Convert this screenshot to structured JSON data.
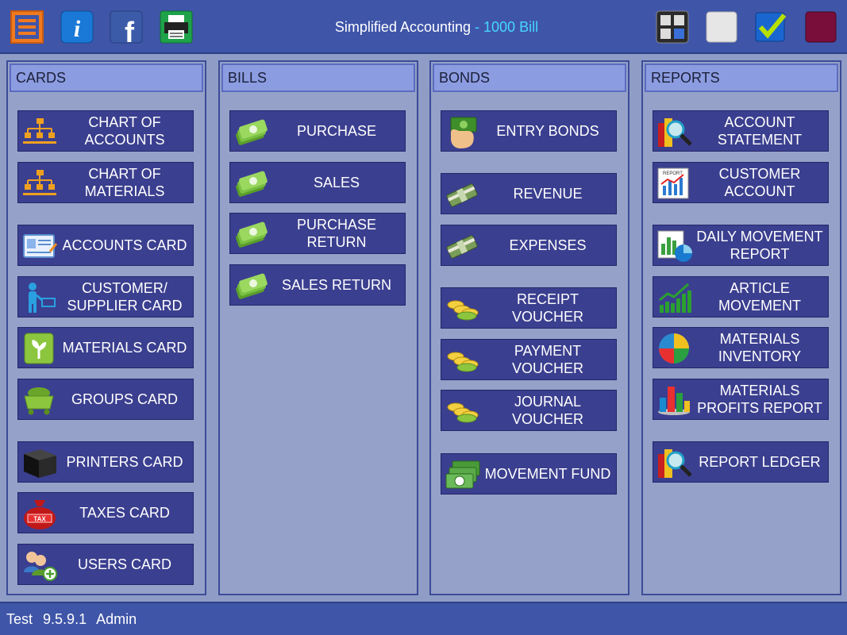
{
  "header": {
    "title_main": "Simplified Accounting",
    "title_accent": " - 1000 Bill",
    "icons": [
      "menu-icon",
      "info-icon",
      "facebook-icon",
      "printer-icon",
      "calculator-icon",
      "blank-tile-icon",
      "checkbox-icon",
      "color-swatch-icon"
    ],
    "accent_color": "#48d6ff",
    "bar_color": "#3f55a8"
  },
  "cards": {
    "title": "CARDS",
    "items": [
      {
        "label": "CHART OF\nACCOUNTS",
        "icon": "org-chart-icon"
      },
      {
        "label": "CHART OF\nMATERIALS",
        "icon": "org-chart-icon"
      },
      {
        "label": "ACCOUNTS CARD",
        "icon": "id-card-icon"
      },
      {
        "label": "CUSTOMER/\nSUPPLIER CARD",
        "icon": "shopper-icon"
      },
      {
        "label": "MATERIALS CARD",
        "icon": "seed-bag-icon"
      },
      {
        "label": "GROUPS CARD",
        "icon": "cart-icon"
      },
      {
        "label": "PRINTERS CARD",
        "icon": "printer-box-icon"
      },
      {
        "label": "TAXES CARD",
        "icon": "tax-bag-icon"
      },
      {
        "label": "USERS CARD",
        "icon": "users-add-icon"
      }
    ]
  },
  "bills": {
    "title": "BILLS",
    "items": [
      {
        "label": "PURCHASE",
        "icon": "cash-stack-icon"
      },
      {
        "label": "SALES",
        "icon": "cash-stack-icon"
      },
      {
        "label": "PURCHASE RETURN",
        "icon": "cash-stack-icon"
      },
      {
        "label": "SALES RETURN",
        "icon": "cash-stack-icon"
      }
    ]
  },
  "bonds": {
    "title": "BONDS",
    "items": [
      {
        "label": "ENTRY BONDS",
        "icon": "cash-hand-icon"
      },
      {
        "label": "REVENUE",
        "icon": "money-bundle-icon"
      },
      {
        "label": "EXPENSES",
        "icon": "money-bundle-icon"
      },
      {
        "label": "RECEIPT VOUCHER",
        "icon": "coins-icon"
      },
      {
        "label": "PAYMENT VOUCHER",
        "icon": "coins-icon"
      },
      {
        "label": "JOURNAL VOUCHER",
        "icon": "coins-icon"
      },
      {
        "label": "MOVEMENT FUND",
        "icon": "bills-stack-icon"
      }
    ]
  },
  "reports": {
    "title": "REPORTS",
    "items": [
      {
        "label": "ACCOUNT\nSTATEMENT",
        "icon": "magnifier-chart-icon"
      },
      {
        "label": "CUSTOMER\nACCOUNT",
        "icon": "report-chart-icon"
      },
      {
        "label": "DAILY MOVEMENT\nREPORT",
        "icon": "pie-report-icon"
      },
      {
        "label": "ARTICLE\nMOVEMENT",
        "icon": "trend-bars-icon"
      },
      {
        "label": "MATERIALS\nINVENTORY",
        "icon": "pie-chart-icon"
      },
      {
        "label": "MATERIALS\nPROFITS REPORT",
        "icon": "bar-3d-icon"
      },
      {
        "label": "REPORT LEDGER",
        "icon": "magnifier-chart-icon"
      }
    ]
  },
  "footer": {
    "user": "Test",
    "version": "9.5.9.1",
    "role": "Admin"
  }
}
